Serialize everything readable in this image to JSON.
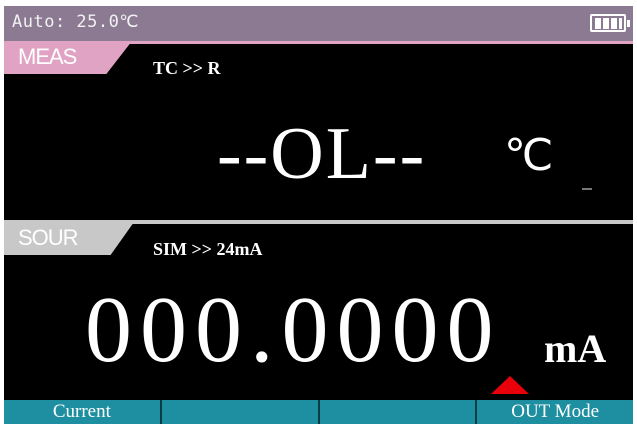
{
  "status": {
    "text": "Auto: 25.0℃",
    "battery_icon": "battery-full-icon"
  },
  "measure": {
    "tab_label": "MEAS",
    "mode": "TC >> R",
    "value": "--OL--",
    "unit": "℃"
  },
  "source": {
    "tab_label": "SOUR",
    "mode": "SIM >> 24mA",
    "value": "000.0000",
    "unit": "mA",
    "cursor_icon": "red-triangle-cursor-icon"
  },
  "softkeys": [
    "Current",
    "",
    "",
    "OUT Mode"
  ],
  "colors": {
    "status_bar": "#8b7a91",
    "meas_tab": "#e0a3c4",
    "sour_tab": "#c8c8c8",
    "softkey": "#1e8fa0",
    "cursor": "#e8000b"
  }
}
